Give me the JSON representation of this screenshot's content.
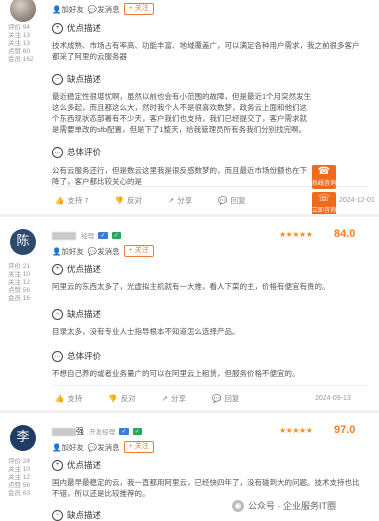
{
  "reviews": [
    {
      "stats": [
        "评价 94",
        "关注 13",
        "关注 13",
        "点赞 60",
        "会员 162"
      ],
      "actions": {
        "add_friend": "加好友",
        "message": "发消息",
        "follow": "+ 关注"
      },
      "advantages": {
        "title": "优点描述",
        "text": "技术成熟、市场占有率高、功能丰富、地域覆盖广，可以满足各种用户需求，我之前很多客户都采了阿里的云服务器"
      },
      "disadvantages": {
        "title": "缺点描述",
        "text": "最近稳定性很堪忧啊，虽然以前也会有小范围的故障，但是最近1个月突然发生这么多起，而且都这么大，然时我个人不是很喜欢数梦，政务云上面和他们这个东西现状态部署有不少天，客户我们也支持，我们已经提交了，客户需求就是需要单改的sfb配置，但是下了1整天，给我管理员所有务我们分别找完啊。"
      },
      "summary": {
        "title": "总体评价",
        "text": "公有云服务还行，但是数云这里我是很反感数梦的，而且最近市场份额也在下降了，客户都比较关心的是"
      },
      "footer": {
        "support": "支持 7",
        "oppose": "反对",
        "share": "分享",
        "reply": "回复"
      },
      "date": "2024-12-01"
    },
    {
      "avatar_letter": "陈",
      "manager_tag": "经理",
      "stars": "★★★★★",
      "score": "84.0",
      "stats": [
        "评价 21",
        "关注 10",
        "关注 12",
        "点赞 56",
        "会员 16"
      ],
      "actions": {
        "add_friend": "加好友",
        "message": "发消息",
        "follow": "+ 关注"
      },
      "advantages": {
        "title": "优点描述",
        "text": "阿里云的东西太多了，光虚拟主机就有一大推，看人下菜的主，价格有便宜有贵的。"
      },
      "disadvantages": {
        "title": "缺点描述",
        "text": "目录太多，没有专业人士指导根本不知道怎么选择产品。"
      },
      "summary": {
        "title": "总体评价",
        "text": "不想自己养的或者业务量广的可以在阿里云上租赁，但服务价格不便宜的。"
      },
      "footer": {
        "support": "支持",
        "oppose": "反对",
        "share": "分享",
        "reply": "回复"
      },
      "date": "2024-09-13"
    },
    {
      "avatar_letter": "李",
      "name_suffix": "强",
      "manager_tag": "开发经理",
      "stars": "★★★★★",
      "score": "97.0",
      "stats": [
        "评价 24",
        "关注 10",
        "关注 12",
        "点赞 56",
        "会员 63"
      ],
      "actions": {
        "add_friend": "加好友",
        "message": "发消息",
        "follow": "+ 关注"
      },
      "advantages": {
        "title": "优点描述",
        "text": "国内最早最稳定的云，我一直都用阿里云，已经快四年了，没有碰到大的问题。技术支持也比不错，所以还是比较推荐的。"
      },
      "disadvantages": {
        "title": "缺点描述",
        "text": ""
      }
    }
  ],
  "float": {
    "call": "热线咨询",
    "consult": "立即咨询"
  },
  "watermark": "公众号 · 企业服务IT圈"
}
